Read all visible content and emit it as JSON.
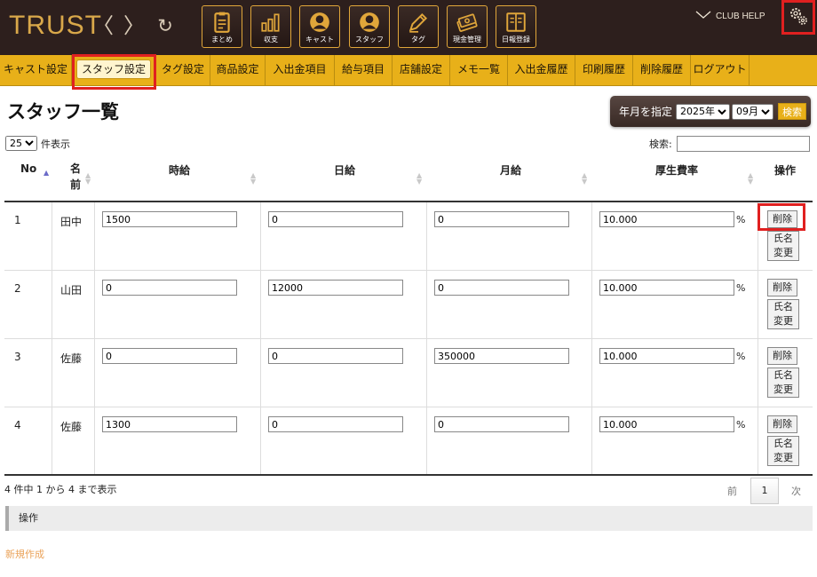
{
  "header": {
    "logo": "TRUST",
    "back": "〈",
    "forward": "〉",
    "reload": "↻",
    "nav_icons": [
      {
        "label": "まとめ",
        "icon": "clipboard-icon"
      },
      {
        "label": "収支",
        "icon": "bar-chart-icon"
      },
      {
        "label": "キャスト",
        "icon": "cast-person-icon"
      },
      {
        "label": "スタッフ",
        "icon": "staff-person-icon"
      },
      {
        "label": "タグ",
        "icon": "pencil-tag-icon"
      },
      {
        "label": "現金管理",
        "icon": "cash-icon"
      },
      {
        "label": "日報登録",
        "icon": "book-icon"
      }
    ],
    "club_help": "CLUB HELP"
  },
  "menu": {
    "items": [
      "キャスト設定",
      "スタッフ設定",
      "タグ設定",
      "商品設定",
      "入出金項目",
      "給与項目",
      "店舗設定",
      "メモ一覧",
      "入出金履歴",
      "印刷履歴",
      "削除履歴",
      "ログアウト"
    ],
    "active": "スタッフ設定"
  },
  "page": {
    "title": "スタッフ一覧",
    "month_label": "年月を指定",
    "year": "2025年",
    "month": "09月",
    "search_button": "検索"
  },
  "controls": {
    "page_length": "25",
    "page_length_suffix": "件表示",
    "search_label": "検索:",
    "search_value": ""
  },
  "table": {
    "headers": {
      "no": "No",
      "name_line1": "名",
      "name_line2": "前",
      "hourly": "時給",
      "daily": "日給",
      "monthly": "月給",
      "welfare": "厚生費率",
      "action": "操作"
    },
    "percent": "%",
    "delete_label": "削除",
    "rename_line1": "氏名",
    "rename_line2": "変更",
    "rows": [
      {
        "no": "1",
        "name": "田中",
        "hourly": "1500",
        "daily": "0",
        "monthly": "0",
        "welfare": "10.000"
      },
      {
        "no": "2",
        "name": "山田",
        "hourly": "0",
        "daily": "12000",
        "monthly": "0",
        "welfare": "10.000"
      },
      {
        "no": "3",
        "name": "佐藤",
        "hourly": "0",
        "daily": "0",
        "monthly": "350000",
        "welfare": "10.000"
      },
      {
        "no": "4",
        "name": "佐藤",
        "hourly": "1300",
        "daily": "0",
        "monthly": "0",
        "welfare": "10.000"
      }
    ]
  },
  "footer": {
    "info": "4 件中 1 から 4 まで表示",
    "prev": "前",
    "current_page": "1",
    "next": "次",
    "operations": "操作",
    "new_link": "新規作成"
  },
  "colors": {
    "topbar": "#2d1f1d",
    "menubar": "#e8b019",
    "accent": "#e0a63a",
    "highlight": "#e02020",
    "link": "#eaa35a"
  }
}
